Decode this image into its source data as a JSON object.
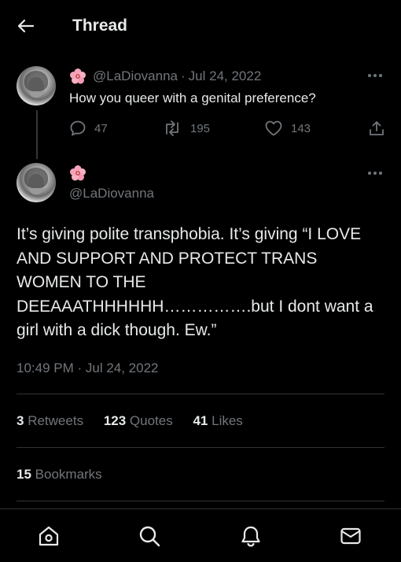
{
  "header": {
    "title": "Thread",
    "back_icon": "arrow-left-icon"
  },
  "parent_tweet": {
    "display_name_emoji": "hibiscus-flower",
    "handle": "@LaDiovanna",
    "separator": "·",
    "date": "Jul 24, 2022",
    "text": "How you queer with a genital preference?",
    "replies": "47",
    "retweets": "195",
    "likes": "143"
  },
  "main_tweet": {
    "display_name_emoji": "hibiscus-flower",
    "handle": "@LaDiovanna",
    "text": "It’s giving polite transphobia. It’s giving “I LOVE\nAND SUPPORT AND PROTECT TRANS\nWOMEN TO THE\nDEEAAATHHHHHH…………….but I dont want a\ngirl with a dick though. Ew.”",
    "timestamp": "10:49 PM · Jul 24, 2022",
    "stats": {
      "retweets_count": "3",
      "retweets_label": "Retweets",
      "quotes_count": "123",
      "quotes_label": "Quotes",
      "likes_count": "41",
      "likes_label": "Likes",
      "bookmarks_count": "15",
      "bookmarks_label": "Bookmarks"
    }
  },
  "nav": {
    "items": [
      "home-icon",
      "search-icon",
      "notifications-icon",
      "messages-icon"
    ]
  },
  "colors": {
    "background": "#000000",
    "text_primary": "#e7e9ea",
    "text_secondary": "#71767b",
    "divider": "#2f3336"
  }
}
